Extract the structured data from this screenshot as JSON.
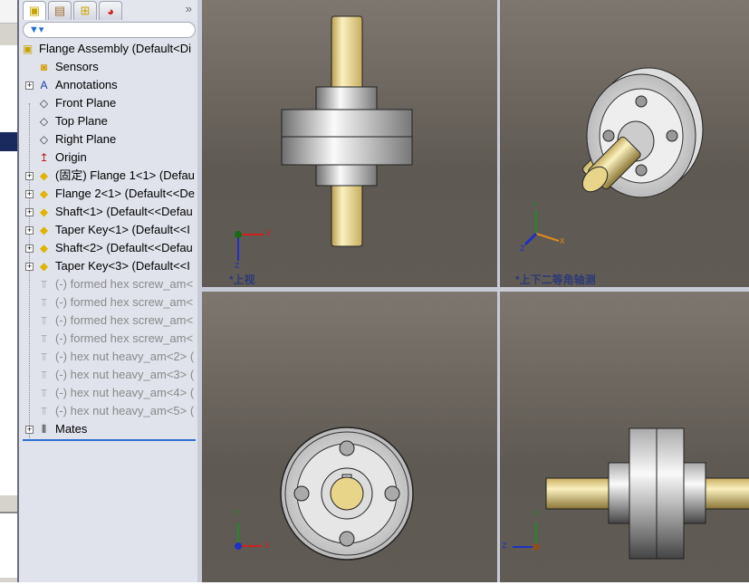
{
  "panel_tabs": [
    {
      "name": "featuremanager",
      "icon": "assembly"
    },
    {
      "name": "propertymanager",
      "icon": "properties"
    },
    {
      "name": "configurationmanager",
      "icon": "config"
    },
    {
      "name": "displaymanager",
      "icon": "appearance"
    }
  ],
  "more": "»",
  "filter": {
    "icon": "filter-icon"
  },
  "tree": [
    {
      "label": "Flange Assembly  (Default<Di",
      "icon": "assembly-icon",
      "root": true
    },
    {
      "label": "Sensors",
      "icon": "sensor-folder-icon"
    },
    {
      "label": "Annotations",
      "icon": "annotations-folder-icon",
      "expand": true
    },
    {
      "label": "Front Plane",
      "icon": "plane-icon"
    },
    {
      "label": "Top Plane",
      "icon": "plane-icon"
    },
    {
      "label": "Right Plane",
      "icon": "plane-icon"
    },
    {
      "label": "Origin",
      "icon": "origin-icon"
    },
    {
      "label": "(固定) Flange 1<1> (Defau",
      "icon": "part-icon",
      "expand": true
    },
    {
      "label": "Flange 2<1> (Default<<De",
      "icon": "part-icon",
      "expand": true
    },
    {
      "label": "Shaft<1> (Default<<Defau",
      "icon": "part-icon",
      "expand": true
    },
    {
      "label": "Taper Key<1> (Default<<I",
      "icon": "part-icon",
      "expand": true
    },
    {
      "label": "Shaft<2> (Default<<Defau",
      "icon": "part-icon",
      "expand": true
    },
    {
      "label": "Taper Key<3> (Default<<I",
      "icon": "part-icon",
      "expand": true
    },
    {
      "label": "(-) formed hex screw_am<",
      "icon": "screw-icon",
      "suppressed": true
    },
    {
      "label": "(-) formed hex screw_am<",
      "icon": "screw-icon",
      "suppressed": true
    },
    {
      "label": "(-) formed hex screw_am<",
      "icon": "screw-icon",
      "suppressed": true
    },
    {
      "label": "(-) formed hex screw_am<",
      "icon": "screw-icon",
      "suppressed": true
    },
    {
      "label": "(-) hex nut heavy_am<2> (",
      "icon": "screw-icon",
      "suppressed": true
    },
    {
      "label": "(-) hex nut heavy_am<3> (",
      "icon": "screw-icon",
      "suppressed": true
    },
    {
      "label": "(-) hex nut heavy_am<4> (",
      "icon": "screw-icon",
      "suppressed": true
    },
    {
      "label": "(-) hex nut heavy_am<5> (",
      "icon": "screw-icon",
      "suppressed": true
    },
    {
      "label": "Mates",
      "icon": "mates-icon",
      "expand": true
    }
  ],
  "viewports": {
    "top_left": {
      "label": "*上视",
      "axes": [
        "X",
        "Z"
      ]
    },
    "top_right": {
      "label": "*上下二等角轴测",
      "axes": [
        "Y",
        "X",
        "Z"
      ]
    },
    "bottom_left": {
      "axes": [
        "Y",
        "X"
      ]
    },
    "bottom_right": {
      "axes": [
        "Y",
        "Z"
      ]
    }
  },
  "colors": {
    "viewport_bg": "#625c56",
    "shaft": "#e8d58a",
    "selection": "#2e6fd0"
  }
}
